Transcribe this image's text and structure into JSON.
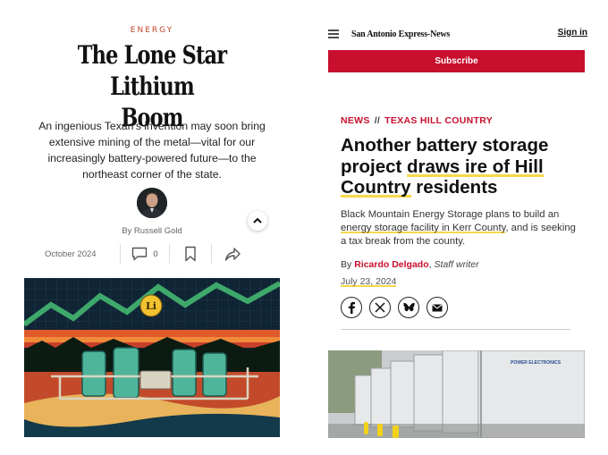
{
  "left": {
    "kicker": "ENERGY",
    "headline_line1": "The Lone Star Lithium",
    "headline_line2": "Boom",
    "dek": "An ingenious Texan’s invention may soon bring extensive mining of the metal—vital for our increasingly battery-powered future—to the northeast corner of the state.",
    "byline": "By Russell Gold",
    "date": "October 2024",
    "comment_count": "0",
    "illustration_badge": "Li",
    "icons": [
      "avatar",
      "chevron-up-icon",
      "comment-icon",
      "bookmark-icon",
      "share-icon"
    ]
  },
  "right": {
    "masthead": "San Antonio Express-News",
    "signin": "Sign in",
    "subscribe": "Subscribe",
    "section_news": "NEWS",
    "section_sep": "//",
    "section_topic": "TEXAS HILL COUNTRY",
    "headline_a": "Another battery storage project ",
    "headline_b": "draws ire of Hill Country",
    "headline_c": " residents",
    "dek_a": "Black Mountain Energy Storage plans to build an ",
    "dek_b": "energy storage facility in Kerr County",
    "dek_c": ", and is seeking a tax break from the county.",
    "by": "By",
    "author": "Ricardo Delgado",
    "role": "Staff writer",
    "date": "July 23, 2024",
    "photo_label": "POWER ELECTRONICS",
    "share_icons": [
      "facebook-icon",
      "x-icon",
      "bluesky-icon",
      "email-icon"
    ]
  },
  "colors": {
    "kicker": "#c0452a",
    "brand_red": "#c8102e",
    "highlight": "#f7d84a"
  }
}
